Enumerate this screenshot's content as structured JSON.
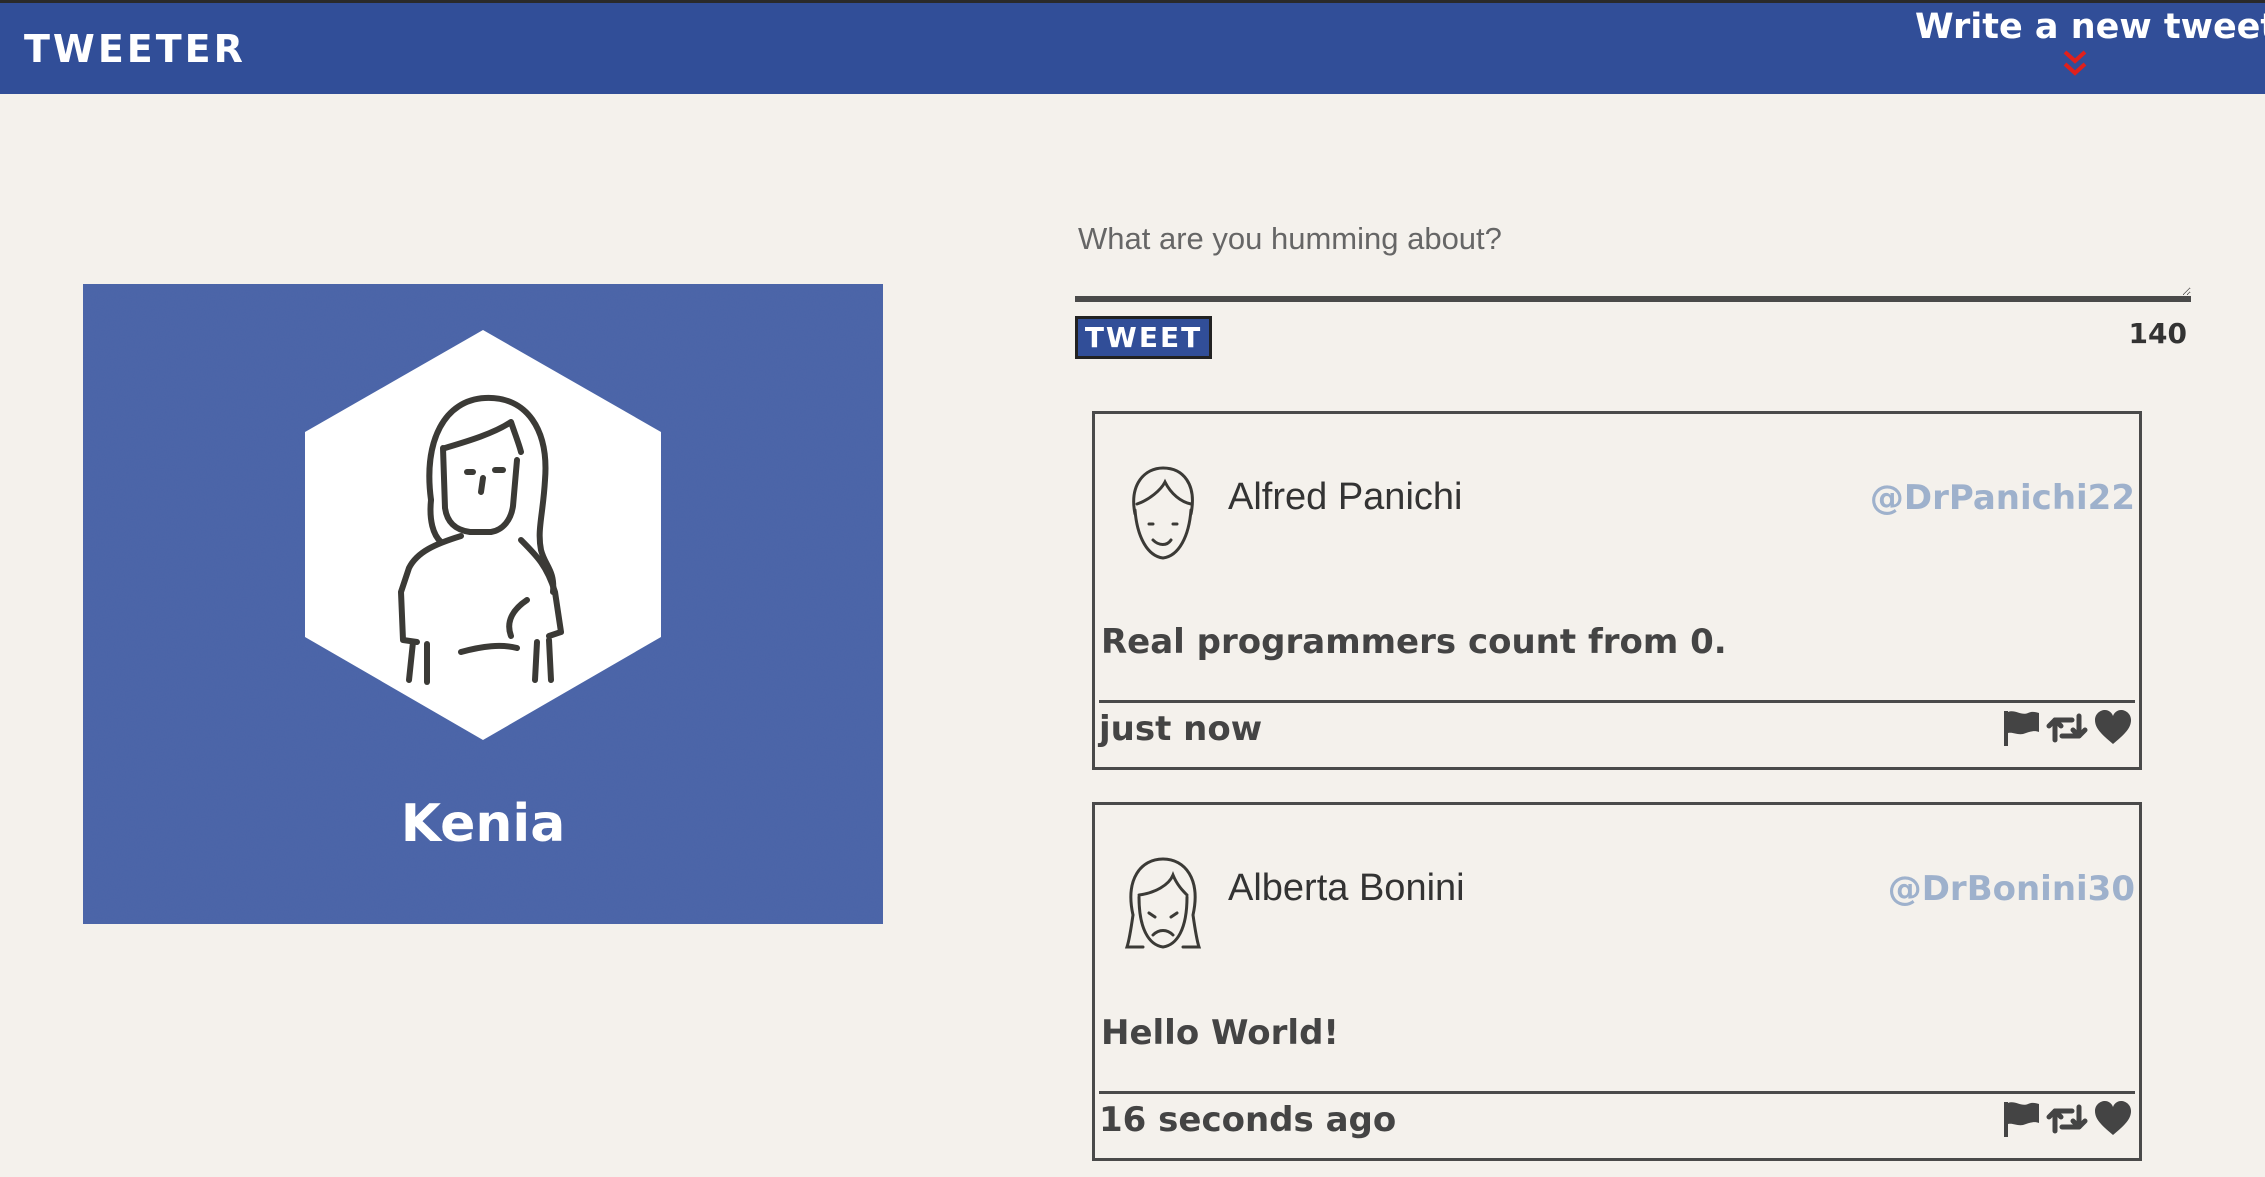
{
  "header": {
    "brand": "TWEETER",
    "compose_link": "Write a new tweet",
    "compose_icon": "double-chevron-down-icon",
    "accent_color": "#e0201c",
    "bar_color": "#314e98"
  },
  "profile": {
    "name": "Kenia",
    "avatar_icon": "female-user-avatar-icon"
  },
  "composer": {
    "placeholder": "What are you humming about?",
    "value": "",
    "button_label": "TWEET",
    "char_count": "140"
  },
  "tweets": [
    {
      "author": "Alfred Panichi",
      "handle": "@DrPanichi22",
      "content": "Real programmers count from 0.",
      "time": "just now",
      "avatar_icon": "male-smiling-avatar-icon"
    },
    {
      "author": "Alberta Bonini",
      "handle": "@DrBonini30",
      "content": "Hello World!",
      "time": "16 seconds ago",
      "avatar_icon": "female-sad-avatar-icon"
    }
  ],
  "tweet_actions": [
    "flag-icon",
    "retweet-icon",
    "heart-icon"
  ]
}
